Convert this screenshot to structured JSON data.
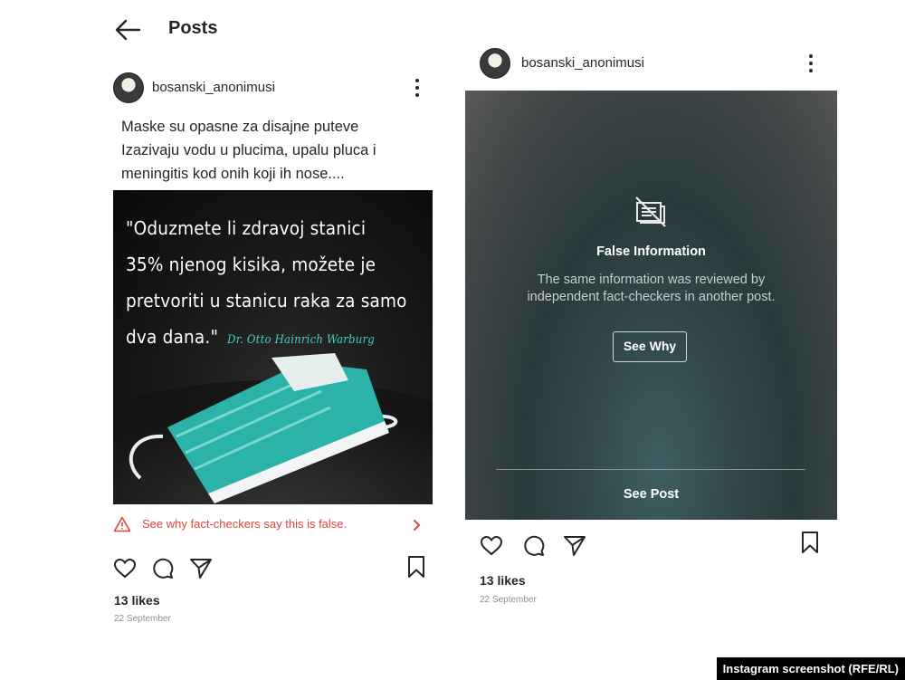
{
  "header": {
    "title": "Posts"
  },
  "post_left": {
    "username": "bosanski_anonimusi",
    "caption_lines": [
      "Maske su opasne za disajne puteve",
      "Izazivaju vodu u plucima, upalu pluca i",
      "meningitis kod onih koji ih nose...."
    ],
    "image_quote_lines": [
      "\"Oduzmete li zdravoj stanici",
      "35% njenog kisika, možete je",
      "pretvoriti u stanicu raka za samo",
      "dva dana.\""
    ],
    "image_author": "Dr. Otto Hainrich Warburg",
    "fact_check_text": "See why fact-checkers say this is false.",
    "likes": "13 likes",
    "date": "22 September"
  },
  "post_right": {
    "username": "bosanski_anonimusi",
    "overlay_title": "False Information",
    "overlay_desc_lines": [
      "The same information was reviewed by",
      "independent fact-checkers in another post."
    ],
    "see_why_label": "See Why",
    "see_post_label": "See Post",
    "likes": "13 likes",
    "date": "22 September"
  },
  "credit": "Instagram screenshot (RFE/RL)",
  "colors": {
    "warning_red": "#e0443e",
    "quote_author": "#3fd1c6",
    "mask": "#2bb3aa"
  },
  "icons": [
    "back-arrow-icon",
    "more-options-icon",
    "heart-icon",
    "comment-icon",
    "share-icon",
    "bookmark-icon",
    "warning-icon",
    "chevron-right-icon",
    "hidden-content-icon"
  ]
}
